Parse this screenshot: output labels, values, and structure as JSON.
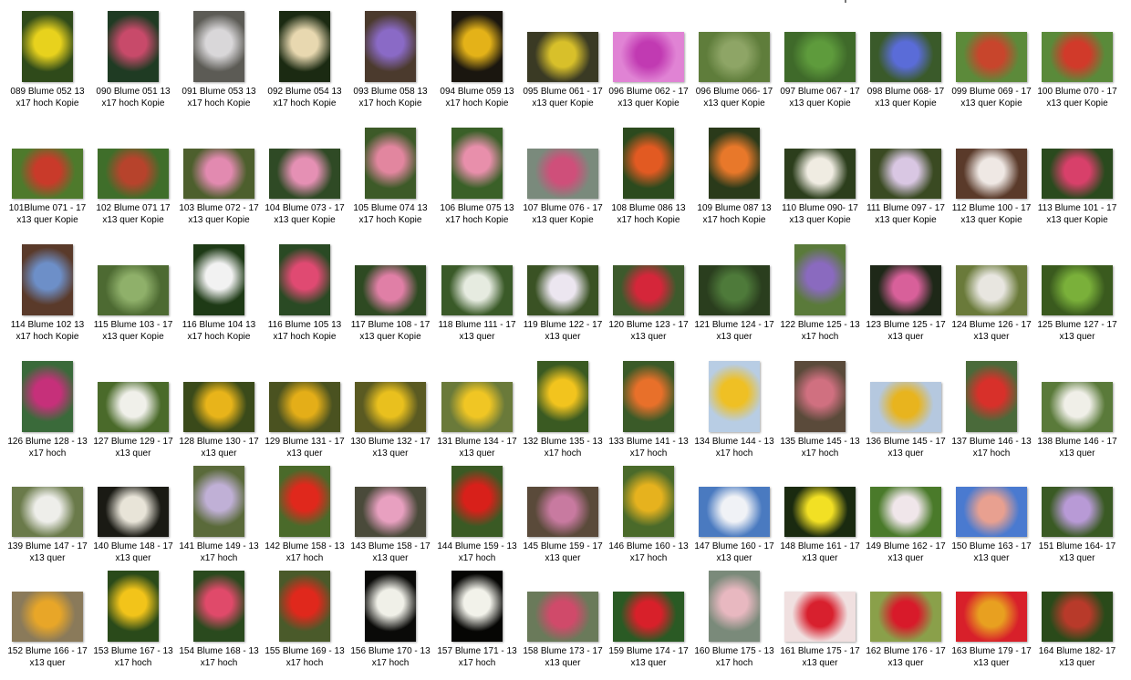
{
  "items": [
    {
      "label": "089 Blume 052 13 x17 hoch Kopie",
      "orient": "hoch",
      "colors": [
        "#e8d21d",
        "#2f4a1a"
      ]
    },
    {
      "label": "090 Blume 051 13 x17 hoch Kopie",
      "orient": "hoch",
      "colors": [
        "#c84a6a",
        "#1f3b23"
      ]
    },
    {
      "label": "091 Blume 053 13 x17 hoch Kopie",
      "orient": "hoch",
      "colors": [
        "#d9d7d9",
        "#5c5b55"
      ]
    },
    {
      "label": "092 Blume 054 13 x17 hoch Kopie",
      "orient": "hoch",
      "colors": [
        "#e8d8b0",
        "#1b2a12"
      ]
    },
    {
      "label": "093 Blume 058 13 x17 hoch Kopie",
      "orient": "hoch",
      "colors": [
        "#8a6ac6",
        "#4b3a2d"
      ]
    },
    {
      "label": "094 Blume 059 13 x17 hoch Kopie",
      "orient": "hoch",
      "colors": [
        "#e4b218",
        "#1a160f"
      ]
    },
    {
      "label": "095 Blume 061 - 17 x13 quer Kopie",
      "orient": "quer",
      "colors": [
        "#d8c02a",
        "#3a3a24"
      ]
    },
    {
      "label": "096 Blume 062 - 17 x13 quer Kopie",
      "orient": "quer",
      "colors": [
        "#c13ab2",
        "#e083d4"
      ]
    },
    {
      "label": "096 Blume 066- 17 x13 quer Kopie",
      "orient": "quer",
      "colors": [
        "#8ea566",
        "#5f7d3b"
      ]
    },
    {
      "label": "097 Blume 067 - 17 x13 quer Kopie",
      "orient": "quer",
      "colors": [
        "#5e9b3c",
        "#3f6a2a"
      ]
    },
    {
      "label": "098 Blume 068- 17 x13 quer Kopie",
      "orient": "quer",
      "colors": [
        "#5a6cd8",
        "#3a5a2a"
      ]
    },
    {
      "label": "099 Blume 069 - 17 x13 quer Kopie",
      "orient": "quer",
      "colors": [
        "#c8452c",
        "#5c8a3a"
      ]
    },
    {
      "label": "100 Blume 070 - 17 x13 quer Kopie",
      "orient": "quer",
      "colors": [
        "#d13a2a",
        "#5a8a3a"
      ]
    },
    {
      "label": "101Blume 071 - 17 x13 quer Kopie",
      "orient": "quer",
      "colors": [
        "#c93a2a",
        "#4e7a2c"
      ]
    },
    {
      "label": "102 Blume 071 17 x13 quer Kopie",
      "orient": "quer",
      "colors": [
        "#b7432c",
        "#3f6e2a"
      ]
    },
    {
      "label": "103 Blume 072 - 17 x13 quer Kopie",
      "orient": "quer",
      "colors": [
        "#e28ab0",
        "#4d5f2d"
      ]
    },
    {
      "label": "104 Blume 073 - 17 x13 quer Kopie",
      "orient": "quer",
      "colors": [
        "#e590b4",
        "#2f4a25"
      ]
    },
    {
      "label": "105 Blume 074 13 x17 hoch Kopie",
      "orient": "hoch",
      "colors": [
        "#e2869f",
        "#3d5a28"
      ]
    },
    {
      "label": "106 Blume 075 13 x17 hoch Kopie",
      "orient": "hoch",
      "colors": [
        "#e88fab",
        "#3a6028"
      ]
    },
    {
      "label": "107 Blume 076 - 17 x13 quer Kopie",
      "orient": "quer",
      "colors": [
        "#cf4f7a",
        "#7a8a7c"
      ]
    },
    {
      "label": "108 Blume 086 13 x17 hoch Kopie",
      "orient": "hoch",
      "colors": [
        "#e25a22",
        "#2c4a1e"
      ]
    },
    {
      "label": "109 Blume 087 13 x17 hoch Kopie",
      "orient": "hoch",
      "colors": [
        "#e8782a",
        "#2a3a1a"
      ]
    },
    {
      "label": "110 Blume 090- 17 x13 quer Kopie",
      "orient": "quer",
      "colors": [
        "#f0ece2",
        "#2c3e1c"
      ]
    },
    {
      "label": "111 Blume 097 - 17 x13 quer Kopie",
      "orient": "quer",
      "colors": [
        "#d9c7e3",
        "#3a4a22"
      ]
    },
    {
      "label": "112 Blume 100 - 17 x13 quer Kopie",
      "orient": "quer",
      "colors": [
        "#efe8e4",
        "#5a3a2a"
      ]
    },
    {
      "label": "113 Blume 101 - 17 x13 quer Kopie",
      "orient": "quer",
      "colors": [
        "#d8406a",
        "#2a4a1e"
      ]
    },
    {
      "label": "114 Blume 102 13 x17 hoch Kopie",
      "orient": "hoch",
      "colors": [
        "#6d8fc8",
        "#5a3a2a"
      ]
    },
    {
      "label": "115 Blume 103 - 17 x13 quer Kopie",
      "orient": "quer",
      "colors": [
        "#8fb06a",
        "#4d6a32"
      ]
    },
    {
      "label": "116 Blume 104 13 x17 hoch Kopie",
      "orient": "hoch",
      "colors": [
        "#f2f2f2",
        "#1e3a16"
      ]
    },
    {
      "label": "116 Blume 105 13 x17 hoch Kopie",
      "orient": "hoch",
      "colors": [
        "#e04a72",
        "#2a4a24"
      ]
    },
    {
      "label": "117 Blume 108 - 17 x13 quer Kopie",
      "orient": "quer",
      "colors": [
        "#e07fa6",
        "#2e4a22"
      ]
    },
    {
      "label": "118 Blume 111 - 17 x13 quer",
      "orient": "quer",
      "colors": [
        "#e6ebe0",
        "#3a5a28"
      ]
    },
    {
      "label": "119 Blume 122 - 17 x13 quer",
      "orient": "quer",
      "colors": [
        "#ece6f0",
        "#3a5224"
      ]
    },
    {
      "label": "120 Blume 123 - 17 x13 quer",
      "orient": "quer",
      "colors": [
        "#d5263a",
        "#3d5a2c"
      ]
    },
    {
      "label": "121 Blume 124 - 17 x13 quer",
      "orient": "quer",
      "colors": [
        "#4e7a3a",
        "#2a3e1e"
      ]
    },
    {
      "label": "122 Blume 125 - 13 x17 hoch",
      "orient": "hoch",
      "colors": [
        "#8a6abf",
        "#5a7a3a"
      ]
    },
    {
      "label": "123 Blume 125 - 17 x13 quer",
      "orient": "quer",
      "colors": [
        "#d8609a",
        "#1e2818"
      ]
    },
    {
      "label": "124 Blume 126 - 17 x13 quer",
      "orient": "quer",
      "colors": [
        "#e8e6e0",
        "#6a7a3a"
      ]
    },
    {
      "label": "125 Blume 127 - 17 x13 quer",
      "orient": "quer",
      "colors": [
        "#7ab03a",
        "#3a5a1e"
      ]
    },
    {
      "label": "126 Blume 128 - 13 x17 hoch",
      "orient": "hoch",
      "colors": [
        "#c6307a",
        "#3a6a3a"
      ]
    },
    {
      "label": "127 Blume 129 - 17 x13 quer",
      "orient": "quer",
      "colors": [
        "#f0f0ea",
        "#4a6a2a"
      ]
    },
    {
      "label": "128 Blume 130 - 17 x13 quer",
      "orient": "quer",
      "colors": [
        "#e8b41a",
        "#3a4a1a"
      ]
    },
    {
      "label": "129 Blume 131 - 17 x13 quer",
      "orient": "quer",
      "colors": [
        "#e4ae18",
        "#4a5220"
      ]
    },
    {
      "label": "130 Blume 132 - 17 x13 quer",
      "orient": "quer",
      "colors": [
        "#e9c01e",
        "#5a5a22"
      ]
    },
    {
      "label": "131 Blume 134 - 17 x13 quer",
      "orient": "quer",
      "colors": [
        "#f0c624",
        "#6a7a3a"
      ]
    },
    {
      "label": "132 Blume 135 - 13 x17 hoch",
      "orient": "hoch",
      "colors": [
        "#f2c41e",
        "#3a5a22"
      ]
    },
    {
      "label": "133 Blume 141 - 13 x17 hoch",
      "orient": "hoch",
      "colors": [
        "#e8702a",
        "#3a5a28"
      ]
    },
    {
      "label": "134 Blume 144 - 13 x17 hoch",
      "orient": "hoch",
      "colors": [
        "#efc024",
        "#b8cde4"
      ]
    },
    {
      "label": "135 Blume 145 - 13 x17 hoch",
      "orient": "hoch",
      "colors": [
        "#d07080",
        "#5a4a3a"
      ]
    },
    {
      "label": "136 Blume 145 - 17 x13 quer",
      "orient": "quer",
      "colors": [
        "#e8b41e",
        "#b5c8df"
      ]
    },
    {
      "label": "137 Blume 146 - 13 x17 hoch",
      "orient": "hoch",
      "colors": [
        "#d8302a",
        "#4a6a3a"
      ]
    },
    {
      "label": "138 Blume 146 - 17 x13 quer",
      "orient": "quer",
      "colors": [
        "#f0efe8",
        "#5a7a3a"
      ]
    },
    {
      "label": "139 Blume 147 - 17 x13 quer",
      "orient": "quer",
      "colors": [
        "#eeeeea",
        "#6a7a4a"
      ]
    },
    {
      "label": "140 Blume 148 - 17 x13 quer",
      "orient": "quer",
      "colors": [
        "#e8e4d8",
        "#1a1a14"
      ]
    },
    {
      "label": "141 Blume 149 - 13 x17 hoch",
      "orient": "hoch",
      "colors": [
        "#c0b0d6",
        "#5a6a3a"
      ]
    },
    {
      "label": "142 Blume 158 - 13 x17 hoch",
      "orient": "hoch",
      "colors": [
        "#e0281c",
        "#4a6a2a"
      ]
    },
    {
      "label": "143 Blume 158 - 17 x13 quer",
      "orient": "quer",
      "colors": [
        "#e8a0c0",
        "#4a4a3a"
      ]
    },
    {
      "label": "144 Blume 159 - 13 x17 hoch",
      "orient": "hoch",
      "colors": [
        "#d8201a",
        "#3a5a24"
      ]
    },
    {
      "label": "145 Blume 159 - 17 x13 quer",
      "orient": "quer",
      "colors": [
        "#c87aa0",
        "#5a4a3a"
      ]
    },
    {
      "label": "146 Blume 160 - 13 x17 hoch",
      "orient": "hoch",
      "colors": [
        "#e6b21e",
        "#4a6a2a"
      ]
    },
    {
      "label": "147 Blume 160 - 17 x13 quer",
      "orient": "quer",
      "colors": [
        "#f0f2f6",
        "#4a7ac0"
      ]
    },
    {
      "label": "148 Blume 161 - 17 x13 quer",
      "orient": "quer",
      "colors": [
        "#f2e024",
        "#1a2a10"
      ]
    },
    {
      "label": "149 Blume 162 - 17 x13 quer",
      "orient": "quer",
      "colors": [
        "#f0e6ea",
        "#4a7a2a"
      ]
    },
    {
      "label": "150 Blume 163 - 17 x13 quer",
      "orient": "quer",
      "colors": [
        "#e8a090",
        "#4a7ad0"
      ]
    },
    {
      "label": "151 Blume 164- 17 x13 quer",
      "orient": "quer",
      "colors": [
        "#b89ad6",
        "#3a5a24"
      ]
    },
    {
      "label": "152 Blume 166 - 17 x13 quer",
      "orient": "quer",
      "colors": [
        "#e8a628",
        "#8a7a5a"
      ]
    },
    {
      "label": "153 Blume 167 - 13 x17 hoch",
      "orient": "hoch",
      "colors": [
        "#f2c41a",
        "#2a4a1a"
      ]
    },
    {
      "label": "154 Blume 168 - 13 x17 hoch",
      "orient": "hoch",
      "colors": [
        "#e04a6a",
        "#2a4a1e"
      ]
    },
    {
      "label": "155 Blume 169 - 13 x17 hoch",
      "orient": "hoch",
      "colors": [
        "#e0281c",
        "#4a5a2a"
      ]
    },
    {
      "label": "156 Blume 170 - 13 x17 hoch",
      "orient": "hoch",
      "colors": [
        "#f0f0e8",
        "#0a0a08"
      ]
    },
    {
      "label": "157 Blume 171 - 13 x17 hoch",
      "orient": "hoch",
      "colors": [
        "#f2f2ea",
        "#060604"
      ]
    },
    {
      "label": "158 Blume 173 - 17 x13 quer",
      "orient": "quer",
      "colors": [
        "#d04a6a",
        "#6a7a5a"
      ]
    },
    {
      "label": "159 Blume 174 - 17 x13 quer",
      "orient": "quer",
      "colors": [
        "#d8202a",
        "#2a5a24"
      ]
    },
    {
      "label": "160 Blume 175 - 13 x17 hoch",
      "orient": "hoch",
      "colors": [
        "#e8b8c0",
        "#7a8a7a"
      ]
    },
    {
      "label": "161 Blume 175 - 17 x13 quer",
      "orient": "quer",
      "colors": [
        "#d8202e",
        "#f0e0e0"
      ]
    },
    {
      "label": "162 Blume 176 - 17 x13 quer",
      "orient": "quer",
      "colors": [
        "#d81a2a",
        "#8aa04a"
      ]
    },
    {
      "label": "163 Blume 179 - 17 x13 quer",
      "orient": "quer",
      "colors": [
        "#e8a020",
        "#d8202a"
      ]
    },
    {
      "label": "164 Blume 182- 17 x13 quer",
      "orient": "quer",
      "colors": [
        "#b83a2a",
        "#2a4a1a"
      ]
    }
  ]
}
